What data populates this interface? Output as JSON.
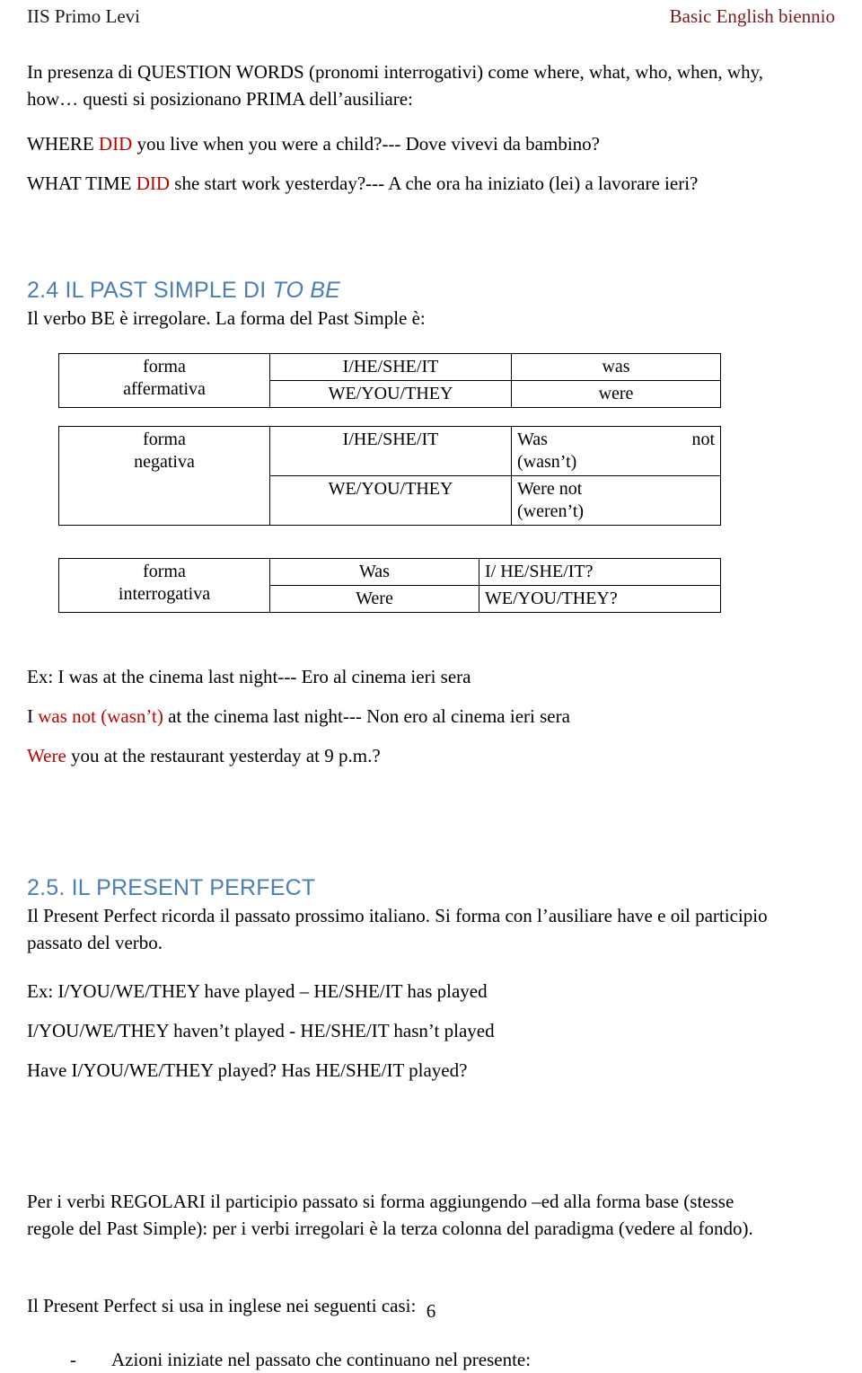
{
  "header": {
    "left": "IIS Primo Levi",
    "right": "Basic English biennio",
    "right_color": "#7b1b1b"
  },
  "accent": {
    "heading_blue": "#4a7ebb",
    "highlight_red": "#c00000"
  },
  "intro": {
    "line1_a": "In presenza di QUESTION WORDS (pronomi interrogativi) come where, what, who, when, why,",
    "line1_b": "how… questi si posizionano PRIMA dell’ausiliare:",
    "example1_pre": "WHERE ",
    "example1_red": "DID",
    "example1_post": " you live when you were a child?--- Dove vivevi da bambino?",
    "example2_pre": "WHAT TIME ",
    "example2_red": "DID",
    "example2_post": " she start work yesterday?--- A che ora ha iniziato (lei) a lavorare ieri?"
  },
  "section_24": {
    "number": "2.4 ",
    "title_roman": "IL PAST SIMPLE DI ",
    "title_italic": "TO BE",
    "lead": "Il verbo BE è irregolare. La forma del Past Simple è:"
  },
  "table_affirmative": {
    "label_line1": "forma",
    "label_line2": "affermativa",
    "rows": [
      {
        "pronouns": "I/HE/SHE/IT",
        "verb": "was"
      },
      {
        "pronouns": "WE/YOU/THEY",
        "verb": "were"
      }
    ]
  },
  "table_negative": {
    "label_line1": "forma",
    "label_line2": "negativa",
    "rows": [
      {
        "pronouns": "I/HE/SHE/IT",
        "verb_a": "Was",
        "verb_b": "not",
        "verb_contraction": "(wasn’t)"
      },
      {
        "pronouns": "WE/YOU/THEY",
        "verb_a": "Were not",
        "verb_b": "",
        "verb_contraction": "(weren’t)"
      }
    ]
  },
  "table_interrogative": {
    "label_line1": "forma",
    "label_line2": "interrogativa",
    "rows": [
      {
        "verb": "Was",
        "pronouns": "I/ HE/SHE/IT?"
      },
      {
        "verb": "Were",
        "pronouns": "WE/YOU/THEY?"
      }
    ]
  },
  "be_examples": {
    "ex1": "Ex: I was at the cinema last night--- Ero al cinema ieri sera",
    "ex2_pre": "I ",
    "ex2_red": "was not (wasn’t)",
    "ex2_post": " at the cinema last night--- Non ero al cinema ieri sera",
    "ex3_red": "Were",
    "ex3_post": " you at the restaurant yesterday at 9 p.m.?"
  },
  "section_25": {
    "number": "2.5. ",
    "title": "IL PRESENT PERFECT",
    "lead_line1": "Il Present Perfect ricorda il passato prossimo italiano. Si forma con l’ausiliare have e oil participio",
    "lead_line2": "passato del verbo.",
    "ex1": "Ex: I/YOU/WE/THEY  have played – HE/SHE/IT has played",
    "ex2": "I/YOU/WE/THEY  haven’t  played - HE/SHE/IT hasn’t played",
    "ex3": "Have I/YOU/WE/THEY  played? Has HE/SHE/IT played?"
  },
  "regular_note": {
    "line1": "Per i verbi REGOLARI il participio passato si forma aggiungendo –ed alla forma base (stesse",
    "line2": "regole del Past Simple): per i verbi irregolari è la terza colonna del paradigma (vedere al fondo)."
  },
  "usage": {
    "intro": "Il Present Perfect si usa in inglese nei seguenti casi:",
    "bullet_marker": "-",
    "bullet_1": "Azioni iniziate nel passato che continuano nel presente:"
  },
  "footer": {
    "page_number": "6"
  }
}
